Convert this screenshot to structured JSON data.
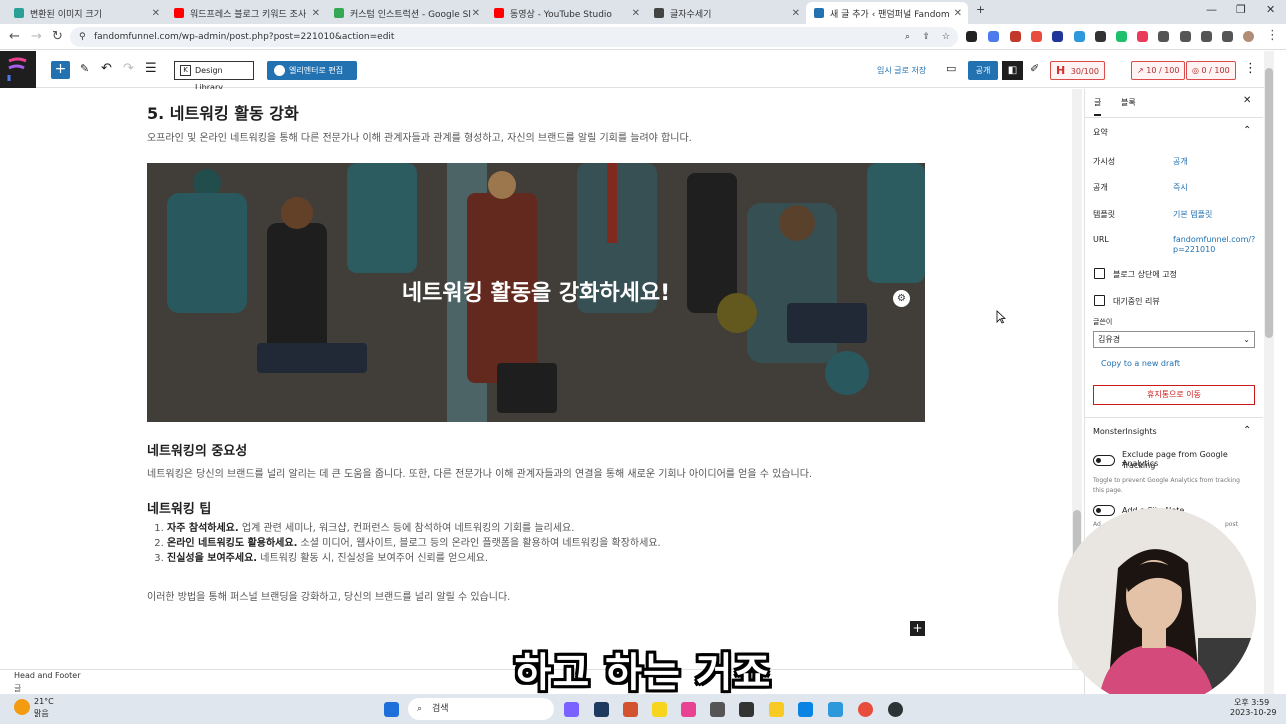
{
  "browser": {
    "tabs": [
      {
        "title": "변환된 이미지 크기",
        "color": "#2aa198"
      },
      {
        "title": "워드프레스 블로그 키워드 조사",
        "color": "#ff0000"
      },
      {
        "title": "커스텀 인스트럭션 - Google Sl",
        "color": "#34a853"
      },
      {
        "title": "동영상 - YouTube Studio",
        "color": "#ff0000"
      },
      {
        "title": "글자수세기",
        "color": "#444444"
      },
      {
        "title": "새 글 추가 ‹ 팬덤퍼널 Fandom",
        "color": "#2271b1",
        "active": true
      }
    ],
    "url": "fandomfunnel.com/wp-admin/post.php?post=221010&action=edit"
  },
  "toolbar": {
    "design_library": "Design Library",
    "elementor": "엘리멘터로 편집",
    "save_draft": "임시 글로 저장",
    "publish": "공개",
    "score1": "30/100",
    "score2": "10 / 100",
    "score3": "0 / 100"
  },
  "content": {
    "section_title": "5. 네트워킹 활동 강화",
    "section_para": "오프라인 및 온라인 네트워킹을 통해 다른 전문가나 이해 관계자들과 관계를 형성하고, 자신의 브랜드를 알릴 기회를 늘려야 합니다.",
    "hero_title": "네트워킹 활동을 강화하세요!",
    "h_importance": "네트워킹의 중요성",
    "p_importance": "네트워킹은 당신의 브랜드를 널리 알리는 데 큰 도움을 줍니다. 또한, 다른 전문가나 이해 관계자들과의 연결을 통해 새로운 기회나 아이디어를 얻을 수 있습니다.",
    "h_tips": "네트워킹 팁",
    "tips": [
      {
        "bold": "자주 참석하세요.",
        "text": " 업계 관련 세미나, 워크샵, 컨퍼런스 등에 참석하여 네트워킹의 기회를 늘리세요."
      },
      {
        "bold": "온라인 네트워킹도 활용하세요.",
        "text": " 소셜 미디어, 웹사이트, 블로그 등의 온라인 플랫폼을 활용하여 네트워킹을 확장하세요."
      },
      {
        "bold": "진실성을 보여주세요.",
        "text": " 네트워킹 활동 시, 진실성을 보여주어 신뢰를 얻으세요."
      }
    ],
    "closing": "이러한 방법을 통해 퍼스널 브랜딩을 강화하고, 당신의 브랜드를 널리 알릴 수 있습니다.",
    "head_footer": "Head and Footer",
    "breadcrumb": "글"
  },
  "sidebar": {
    "tab_post": "글",
    "tab_block": "블록",
    "summary": "요약",
    "visibility_label": "가시성",
    "visibility_value": "공개",
    "publish_label": "공개",
    "publish_value": "즉시",
    "template_label": "템플릿",
    "template_value": "기본 템플릿",
    "url_label": "URL",
    "url_value_1": "fandomfunnel.com/?",
    "url_value_2": "p=221010",
    "sticky": "블로그 상단에 고정",
    "pending": "대기중인 리뷰",
    "author_label": "글쓴이",
    "author_value": "김유경",
    "copy_draft": "Copy to a new draft",
    "trash": "휴지통으로 이동",
    "monsterinsights": "MonsterInsights",
    "exclude_ga_1": "Exclude page from Google Analytics",
    "exclude_ga_2": "Tracking",
    "ga_help_1": "Toggle to prevent Google Analytics from tracking",
    "ga_help_2": "this page.",
    "add_note": "Add a Site Note",
    "ad_text": "Ad",
    "post_text": "post"
  },
  "subtitle": "하고 하는 거죠",
  "taskbar": {
    "temp": "21°C",
    "weather": "맑음",
    "search": "검색",
    "time": "오후 3:59",
    "date": "2023-10-29"
  }
}
